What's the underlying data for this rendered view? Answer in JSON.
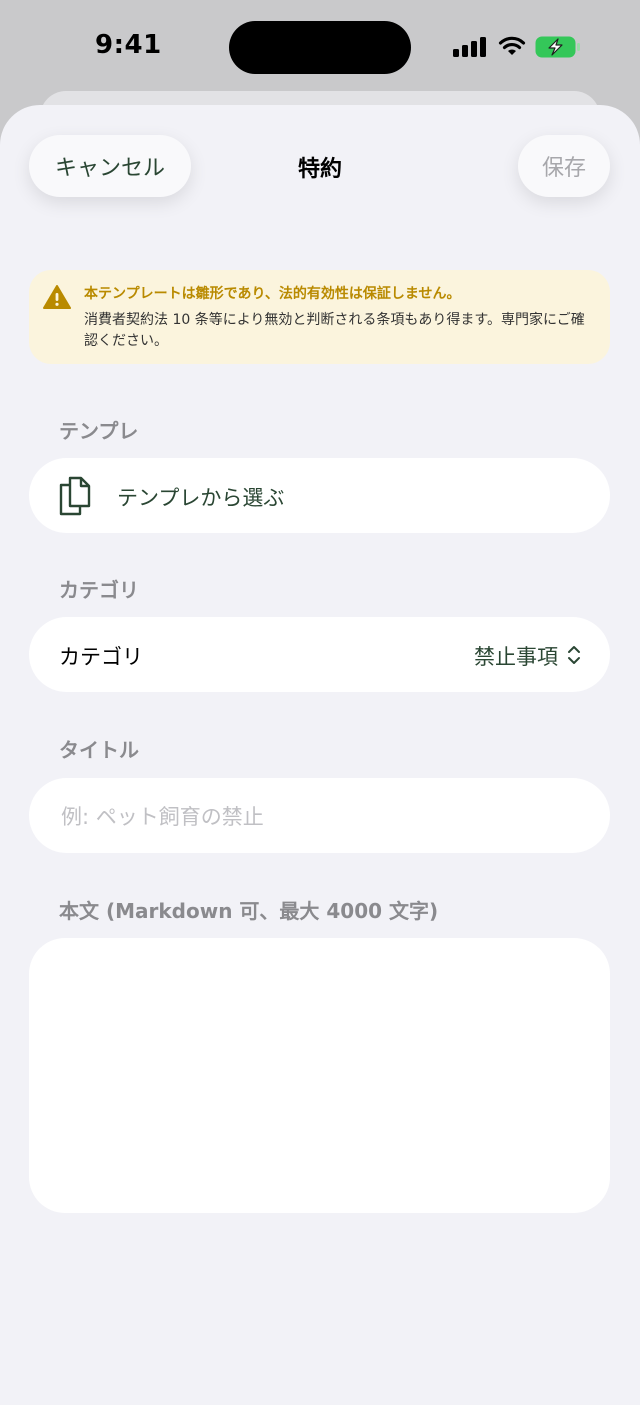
{
  "status": {
    "time": "9:41"
  },
  "nav": {
    "cancel": "キャンセル",
    "title": "特約",
    "save": "保存"
  },
  "warning": {
    "title": "本テンプレートは雛形であり、法的有効性は保証しません。",
    "body": "消費者契約法 10 条等により無効と判断される条項もあり得ます。専門家にご確認ください。"
  },
  "template_section": {
    "label": "テンプレ",
    "button": "テンプレから選ぶ"
  },
  "category_section": {
    "label": "カテゴリ",
    "field_label": "カテゴリ",
    "value": "禁止事項"
  },
  "title_section": {
    "label": "タイトル",
    "placeholder": "例: ペット飼育の禁止",
    "value": ""
  },
  "body_section": {
    "label": "本文 (Markdown 可、最大 4000 文字)",
    "value": ""
  },
  "colors": {
    "accent": "#2a4633",
    "warning_bg": "#fbf4dd",
    "warning_text": "#b98a00",
    "battery_green": "#34c759"
  },
  "icons": [
    "warning-icon",
    "documents-icon",
    "chevron-updown-icon",
    "signal-icon",
    "wifi-icon",
    "battery-charging-icon"
  ]
}
